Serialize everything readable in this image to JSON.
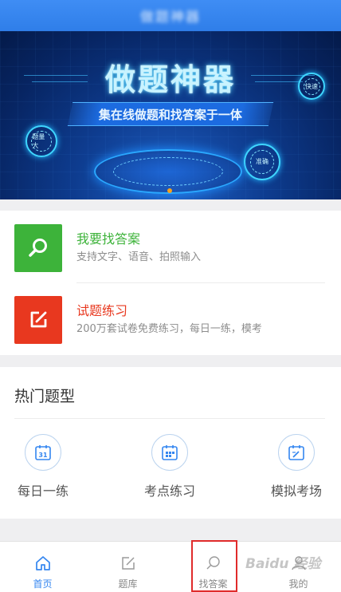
{
  "header": {
    "title": "做题神器"
  },
  "banner": {
    "title": "做题神器",
    "subtitle": "集在线做题和找答案于一体",
    "badges": [
      "题量大",
      "快速",
      "准确"
    ],
    "indicator_color": "#f7a21b"
  },
  "features": [
    {
      "title": "我要找答案",
      "desc": "支持文字、语音、拍照输入",
      "icon": "search-icon",
      "color": "#3db33a"
    },
    {
      "title": "试题练习",
      "desc": "200万套试卷免费练习，每日一练，模考",
      "icon": "edit-icon",
      "color": "#e8381f"
    }
  ],
  "hot": {
    "title": "热门题型",
    "items": [
      {
        "label": "每日一练",
        "icon": "calendar-31-icon"
      },
      {
        "label": "考点练习",
        "icon": "calendar-grid-icon"
      },
      {
        "label": "模拟考场",
        "icon": "calendar-edit-icon"
      }
    ]
  },
  "nav": {
    "items": [
      {
        "label": "首页",
        "icon": "home-icon",
        "active": true
      },
      {
        "label": "题库",
        "icon": "edit-icon",
        "active": false
      },
      {
        "label": "找答案",
        "icon": "search-icon",
        "active": false
      },
      {
        "label": "我的",
        "icon": "user-icon",
        "active": false
      }
    ]
  },
  "watermark": "Baidu 经验",
  "colors": {
    "accent": "#3486f0",
    "green": "#3db33a",
    "red": "#e8381f",
    "highlight": "#e02b2b"
  }
}
